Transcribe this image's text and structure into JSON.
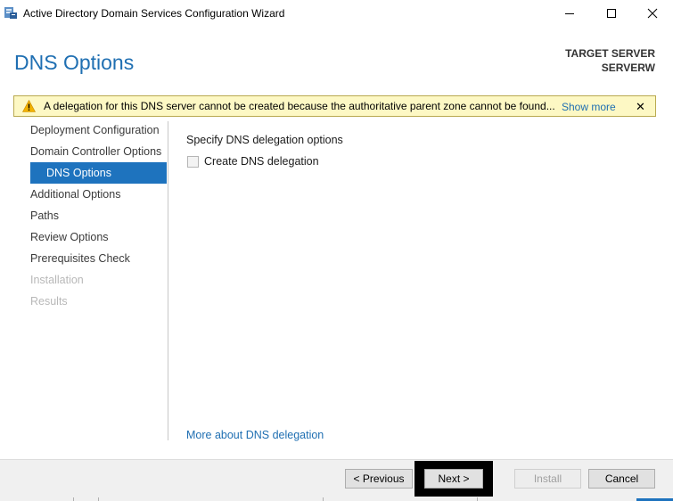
{
  "window": {
    "title": "Active Directory Domain Services Configuration Wizard",
    "icons": {
      "app": "ad-ds-wizard-icon",
      "minimize": "minimize-icon",
      "maximize": "maximize-icon",
      "close": "close-icon"
    }
  },
  "header": {
    "page_title": "DNS Options",
    "target_label": "TARGET SERVER",
    "target_name": "SERVERW"
  },
  "warning": {
    "icon": "warning-icon",
    "message": "A delegation for this DNS server cannot be created because the authoritative parent zone cannot be found...",
    "show_more": "Show more",
    "close_glyph": "✕"
  },
  "nav": {
    "items": [
      {
        "label": "Deployment Configuration",
        "state": "normal"
      },
      {
        "label": "Domain Controller Options",
        "state": "normal"
      },
      {
        "label": "DNS Options",
        "state": "active"
      },
      {
        "label": "Additional Options",
        "state": "normal"
      },
      {
        "label": "Paths",
        "state": "normal"
      },
      {
        "label": "Review Options",
        "state": "normal"
      },
      {
        "label": "Prerequisites Check",
        "state": "normal"
      },
      {
        "label": "Installation",
        "state": "disabled"
      },
      {
        "label": "Results",
        "state": "disabled"
      }
    ]
  },
  "content": {
    "heading": "Specify DNS delegation options",
    "checkbox_label": "Create DNS delegation",
    "checkbox_checked": false,
    "more_link": "More about DNS delegation"
  },
  "footer": {
    "previous": "< Previous",
    "next": "Next >",
    "install": "Install",
    "cancel": "Cancel"
  },
  "colors": {
    "accent": "#1e73be",
    "title_blue": "#1f6fb2",
    "warning_bg": "#fdf8c4"
  }
}
